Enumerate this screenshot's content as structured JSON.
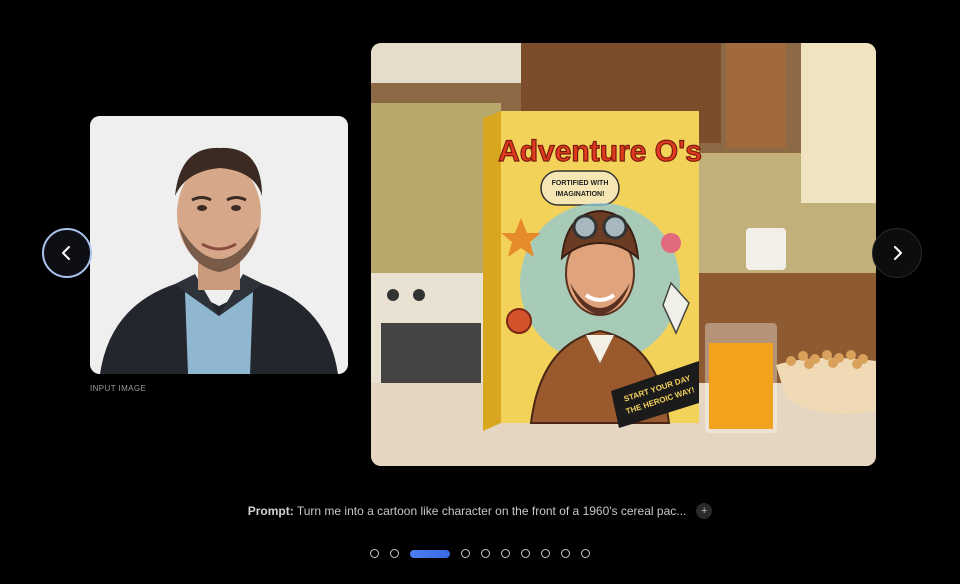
{
  "input_panel": {
    "label": "INPUT IMAGE",
    "image_description_icon": "portrait-photo"
  },
  "output_panel": {
    "box_title": "Adventure O's",
    "box_badge": "FORTIFIED WITH IMAGINATION!",
    "box_tagline_line1": "START YOUR DAY",
    "box_tagline_line2": "THE HEROIC WAY!"
  },
  "navigation": {
    "prev_icon": "chevron-left-icon",
    "next_icon": "chevron-right-icon"
  },
  "prompt": {
    "label": "Prompt:",
    "text": "Turn me into a cartoon like character on the front of a 1960's cereal pac...",
    "expand_label": "+"
  },
  "pagination": {
    "total": 11,
    "active_index": 2
  },
  "colors": {
    "accent_blue": "#3a6ae8",
    "background": "#000000"
  }
}
